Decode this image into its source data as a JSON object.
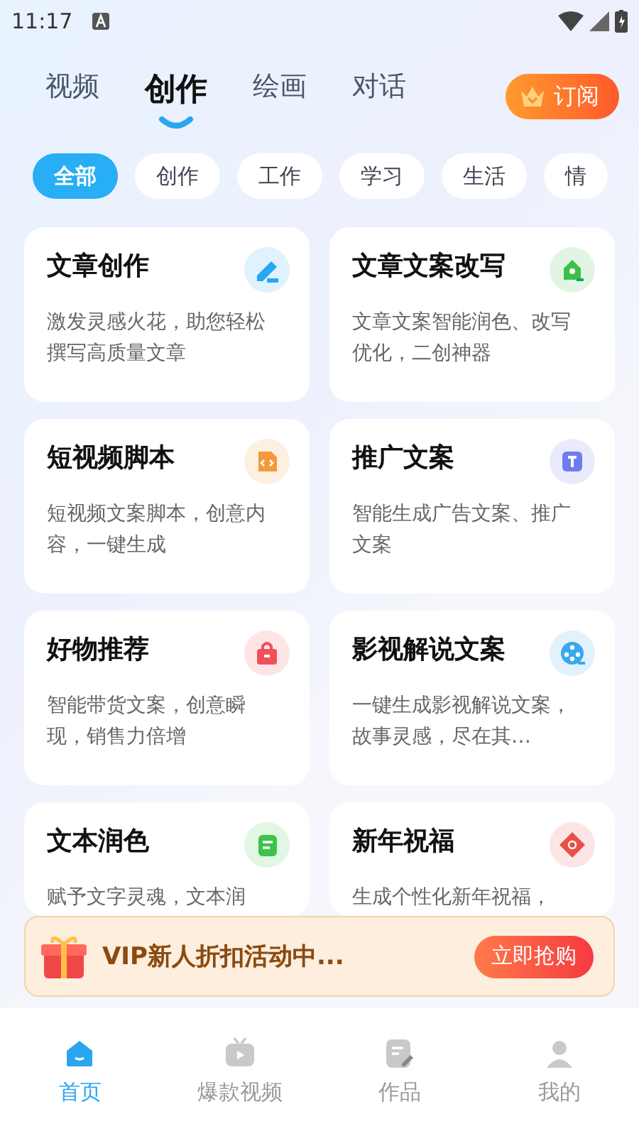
{
  "status_bar": {
    "time": "11:17"
  },
  "top_tabs": [
    {
      "label": "视频",
      "selected": false
    },
    {
      "label": "创作",
      "selected": true
    },
    {
      "label": "绘画",
      "selected": false
    },
    {
      "label": "对话",
      "selected": false
    }
  ],
  "subscribe_button": {
    "label": "订阅"
  },
  "chips": [
    {
      "label": "全部",
      "selected": true
    },
    {
      "label": "创作",
      "selected": false
    },
    {
      "label": "工作",
      "selected": false
    },
    {
      "label": "学习",
      "selected": false
    },
    {
      "label": "生活",
      "selected": false
    },
    {
      "label": "情",
      "selected": false
    }
  ],
  "cards": [
    {
      "title": "文章创作",
      "description": "激发灵感火花，助您轻松撰写高质量文章",
      "color": "#2aa6f0"
    },
    {
      "title": "文章文案改写",
      "description": "文章文案智能润色、改写优化，二创神器",
      "color": "#3cbf4a"
    },
    {
      "title": "短视频脚本",
      "description": "短视频文案脚本，创意内容，一键生成",
      "color": "#f39a3a"
    },
    {
      "title": "推广文案",
      "description": "智能生成广告文案、推广文案",
      "color": "#6f7cf0"
    },
    {
      "title": "好物推荐",
      "description": "智能带货文案，创意瞬现，销售力倍增",
      "color": "#f0505a"
    },
    {
      "title": "影视解说文案",
      "description": "一键生成影视解说文案，故事灵感，尽在其…",
      "color": "#3aa8ee"
    },
    {
      "title": "文本润色",
      "description": "赋予文字灵魂，文本润",
      "color": "#3cc44a"
    },
    {
      "title": "新年祝福",
      "description": "生成个性化新年祝福，",
      "color": "#e8504a"
    }
  ],
  "promo_banner": {
    "text": "VIP新人折扣活动中...",
    "button": "立即抢购"
  },
  "bottom_nav": [
    {
      "label": "首页",
      "selected": true
    },
    {
      "label": "爆款视频",
      "selected": false
    },
    {
      "label": "作品",
      "selected": false
    },
    {
      "label": "我的",
      "selected": false
    }
  ]
}
